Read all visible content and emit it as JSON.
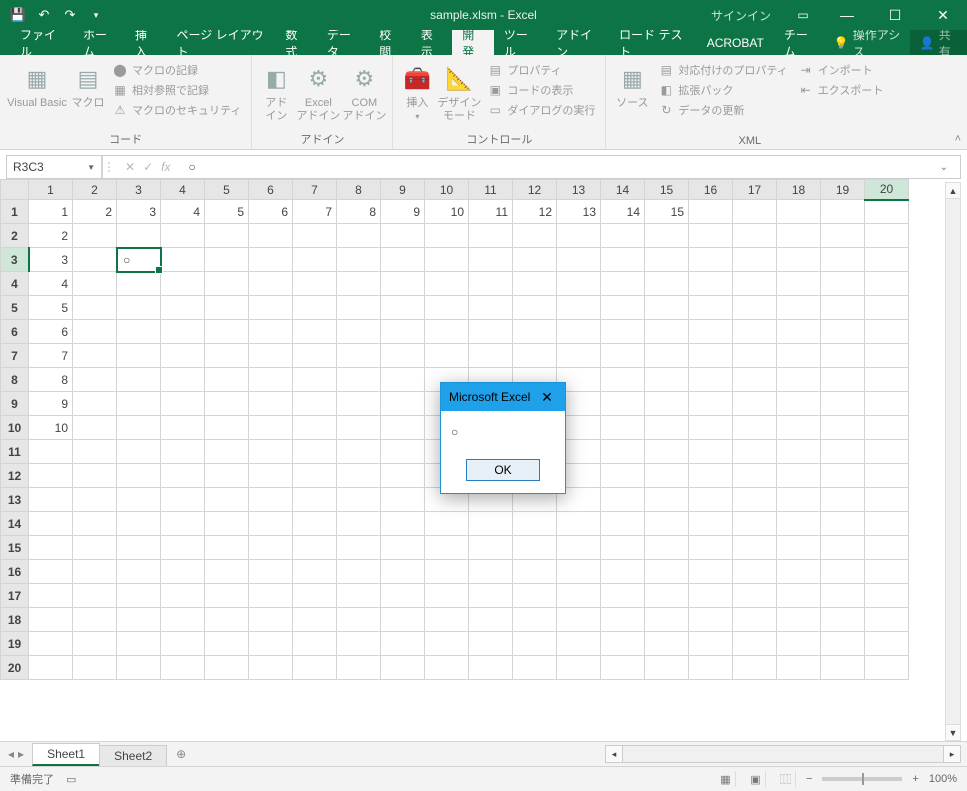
{
  "titlebar": {
    "filename": "sample.xlsm  -  Excel",
    "signin": "サインイン"
  },
  "tabs": {
    "file": "ファイル",
    "home": "ホーム",
    "insert": "挿入",
    "pagelayout": "ページ レイアウト",
    "formulas": "数式",
    "data": "データ",
    "review": "校閲",
    "view": "表示",
    "developer": "開発",
    "tools": "ツール",
    "addins": "アドイン",
    "loadtest": "ロード テスト",
    "acrobat": "ACROBAT",
    "team": "チーム",
    "tell": "操作アシス",
    "share": "共有"
  },
  "ribbon": {
    "code": {
      "vb": "Visual Basic",
      "macros": "マクロ",
      "record": "マクロの記録",
      "relative": "相対参照で記録",
      "security": "マクロのセキュリティ",
      "label": "コード"
    },
    "addins": {
      "addin": "アド\nイン",
      "excel_addin": "Excel\nアドイン",
      "com_addin": "COM\nアドイン",
      "label": "アドイン"
    },
    "controls": {
      "insert": "挿入",
      "design": "デザイン\nモード",
      "properties": "プロパティ",
      "viewcode": "コードの表示",
      "dialog": "ダイアログの実行",
      "label": "コントロール"
    },
    "xml": {
      "source": "ソース",
      "mapprops": "対応付けのプロパティ",
      "expansion": "拡張パック",
      "refresh": "データの更新",
      "import": "インポート",
      "export": "エクスポート",
      "label": "XML"
    }
  },
  "namebox": "R3C3",
  "formula": "○",
  "column_headers": [
    "1",
    "2",
    "3",
    "4",
    "5",
    "6",
    "7",
    "8",
    "9",
    "10",
    "11",
    "12",
    "13",
    "14",
    "15",
    "16",
    "17",
    "18",
    "19",
    "20"
  ],
  "rows": [
    {
      "h": "1",
      "cells": [
        "1",
        "2",
        "3",
        "4",
        "5",
        "6",
        "7",
        "8",
        "9",
        "10",
        "11",
        "12",
        "13",
        "14",
        "15",
        "",
        "",
        "",
        "",
        ""
      ]
    },
    {
      "h": "2",
      "cells": [
        "2",
        "",
        "",
        "",
        "",
        "",
        "",
        "",
        "",
        "",
        "",
        "",
        "",
        "",
        "",
        "",
        "",
        "",
        "",
        ""
      ]
    },
    {
      "h": "3",
      "cells": [
        "3",
        "",
        "○",
        "",
        "",
        "",
        "",
        "",
        "",
        "",
        "",
        "",
        "",
        "",
        "",
        "",
        "",
        "",
        "",
        ""
      ]
    },
    {
      "h": "4",
      "cells": [
        "4",
        "",
        "",
        "",
        "",
        "",
        "",
        "",
        "",
        "",
        "",
        "",
        "",
        "",
        "",
        "",
        "",
        "",
        "",
        ""
      ]
    },
    {
      "h": "5",
      "cells": [
        "5",
        "",
        "",
        "",
        "",
        "",
        "",
        "",
        "",
        "",
        "",
        "",
        "",
        "",
        "",
        "",
        "",
        "",
        "",
        ""
      ]
    },
    {
      "h": "6",
      "cells": [
        "6",
        "",
        "",
        "",
        "",
        "",
        "",
        "",
        "",
        "",
        "",
        "",
        "",
        "",
        "",
        "",
        "",
        "",
        "",
        ""
      ]
    },
    {
      "h": "7",
      "cells": [
        "7",
        "",
        "",
        "",
        "",
        "",
        "",
        "",
        "",
        "",
        "",
        "",
        "",
        "",
        "",
        "",
        "",
        "",
        "",
        ""
      ]
    },
    {
      "h": "8",
      "cells": [
        "8",
        "",
        "",
        "",
        "",
        "",
        "",
        "",
        "",
        "",
        "",
        "",
        "",
        "",
        "",
        "",
        "",
        "",
        "",
        ""
      ]
    },
    {
      "h": "9",
      "cells": [
        "9",
        "",
        "",
        "",
        "",
        "",
        "",
        "",
        "",
        "",
        "",
        "",
        "",
        "",
        "",
        "",
        "",
        "",
        "",
        ""
      ]
    },
    {
      "h": "10",
      "cells": [
        "10",
        "",
        "",
        "",
        "",
        "",
        "",
        "",
        "",
        "",
        "",
        "",
        "",
        "",
        "",
        "",
        "",
        "",
        "",
        ""
      ]
    },
    {
      "h": "11",
      "cells": [
        "",
        "",
        "",
        "",
        "",
        "",
        "",
        "",
        "",
        "",
        "",
        "",
        "",
        "",
        "",
        "",
        "",
        "",
        "",
        ""
      ]
    },
    {
      "h": "12",
      "cells": [
        "",
        "",
        "",
        "",
        "",
        "",
        "",
        "",
        "",
        "",
        "",
        "",
        "",
        "",
        "",
        "",
        "",
        "",
        "",
        ""
      ]
    },
    {
      "h": "13",
      "cells": [
        "",
        "",
        "",
        "",
        "",
        "",
        "",
        "",
        "",
        "",
        "",
        "",
        "",
        "",
        "",
        "",
        "",
        "",
        "",
        ""
      ]
    },
    {
      "h": "14",
      "cells": [
        "",
        "",
        "",
        "",
        "",
        "",
        "",
        "",
        "",
        "",
        "",
        "",
        "",
        "",
        "",
        "",
        "",
        "",
        "",
        ""
      ]
    },
    {
      "h": "15",
      "cells": [
        "",
        "",
        "",
        "",
        "",
        "",
        "",
        "",
        "",
        "",
        "",
        "",
        "",
        "",
        "",
        "",
        "",
        "",
        "",
        ""
      ]
    },
    {
      "h": "16",
      "cells": [
        "",
        "",
        "",
        "",
        "",
        "",
        "",
        "",
        "",
        "",
        "",
        "",
        "",
        "",
        "",
        "",
        "",
        "",
        "",
        ""
      ]
    },
    {
      "h": "17",
      "cells": [
        "",
        "",
        "",
        "",
        "",
        "",
        "",
        "",
        "",
        "",
        "",
        "",
        "",
        "",
        "",
        "",
        "",
        "",
        "",
        ""
      ]
    },
    {
      "h": "18",
      "cells": [
        "",
        "",
        "",
        "",
        "",
        "",
        "",
        "",
        "",
        "",
        "",
        "",
        "",
        "",
        "",
        "",
        "",
        "",
        "",
        ""
      ]
    },
    {
      "h": "19",
      "cells": [
        "",
        "",
        "",
        "",
        "",
        "",
        "",
        "",
        "",
        "",
        "",
        "",
        "",
        "",
        "",
        "",
        "",
        "",
        "",
        ""
      ]
    },
    {
      "h": "20",
      "cells": [
        "",
        "",
        "",
        "",
        "",
        "",
        "",
        "",
        "",
        "",
        "",
        "",
        "",
        "",
        "",
        "",
        "",
        "",
        "",
        ""
      ]
    }
  ],
  "selected": {
    "row": 2,
    "col": 2
  },
  "sheets": {
    "s1": "Sheet1",
    "s2": "Sheet2"
  },
  "status": {
    "ready": "準備完了",
    "zoom": "100%"
  },
  "dialog": {
    "title": "Microsoft Excel",
    "body": "○",
    "ok": "OK"
  }
}
